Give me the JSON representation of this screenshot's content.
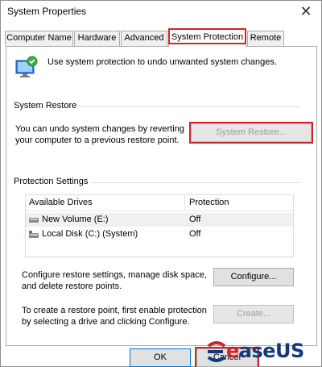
{
  "window": {
    "title": "System Properties",
    "close_glyph": "✕"
  },
  "tabs": [
    {
      "label": "Computer Name"
    },
    {
      "label": "Hardware"
    },
    {
      "label": "Advanced"
    },
    {
      "label": "System Protection",
      "active": true
    },
    {
      "label": "Remote"
    }
  ],
  "intro": {
    "icon": "system-protection-icon",
    "text": "Use system protection to undo unwanted system changes."
  },
  "system_restore": {
    "group_label": "System Restore",
    "description_line1": "You can undo system changes by reverting",
    "description_line2": "your computer to a previous restore point.",
    "button_label": "System Restore..."
  },
  "protection_settings": {
    "group_label": "Protection Settings",
    "columns": [
      "Available Drives",
      "Protection"
    ],
    "drives": [
      {
        "name": "New Volume (E:)",
        "protection": "Off",
        "icon": "drive-icon",
        "selected": true
      },
      {
        "name": "Local Disk (C:) (System)",
        "protection": "Off",
        "icon": "system-drive-icon",
        "selected": false
      }
    ]
  },
  "configure": {
    "text_line1": "Configure restore settings, manage disk space,",
    "text_line2": "and delete restore points.",
    "button_label": "Configure..."
  },
  "create": {
    "text_line1": "To create a restore point, first enable protection",
    "text_line2": "by selecting a drive and clicking Configure.",
    "button_label": "Create..."
  },
  "footer": {
    "ok_label": "OK",
    "cancel_label": "Cancel"
  },
  "watermark": {
    "prefix": "e",
    "suffix": "aseUS"
  },
  "colors": {
    "highlight": "#d0232a",
    "brand": "#123a7a"
  }
}
